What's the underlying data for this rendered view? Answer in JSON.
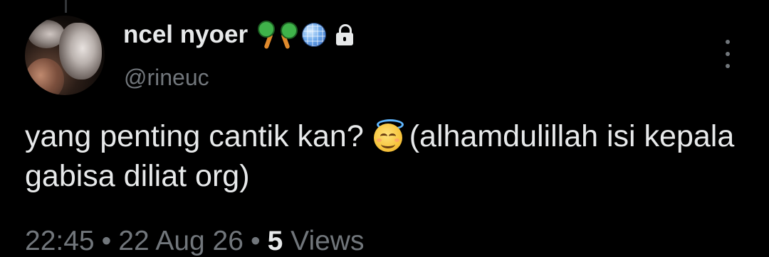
{
  "tweet": {
    "author": {
      "display_name": "ncel nyoer",
      "handle": "@rineuc",
      "badges": [
        "maracas-icon",
        "disco-ball-icon",
        "lock-icon"
      ]
    },
    "text_before_emoji": "yang penting cantik kan?",
    "emoji": "smiling-face-with-halo-icon",
    "text_after_emoji": "(alhamdulillah isi kepala gabisa diliat org)",
    "time": "22:45",
    "date": "22 Aug 26",
    "separator": "•",
    "views_count": "5",
    "views_label": "Views"
  },
  "colors": {
    "background": "#000000",
    "primary_text": "#e7e9ea",
    "secondary_text": "#71767b",
    "thread_line": "#333639"
  }
}
